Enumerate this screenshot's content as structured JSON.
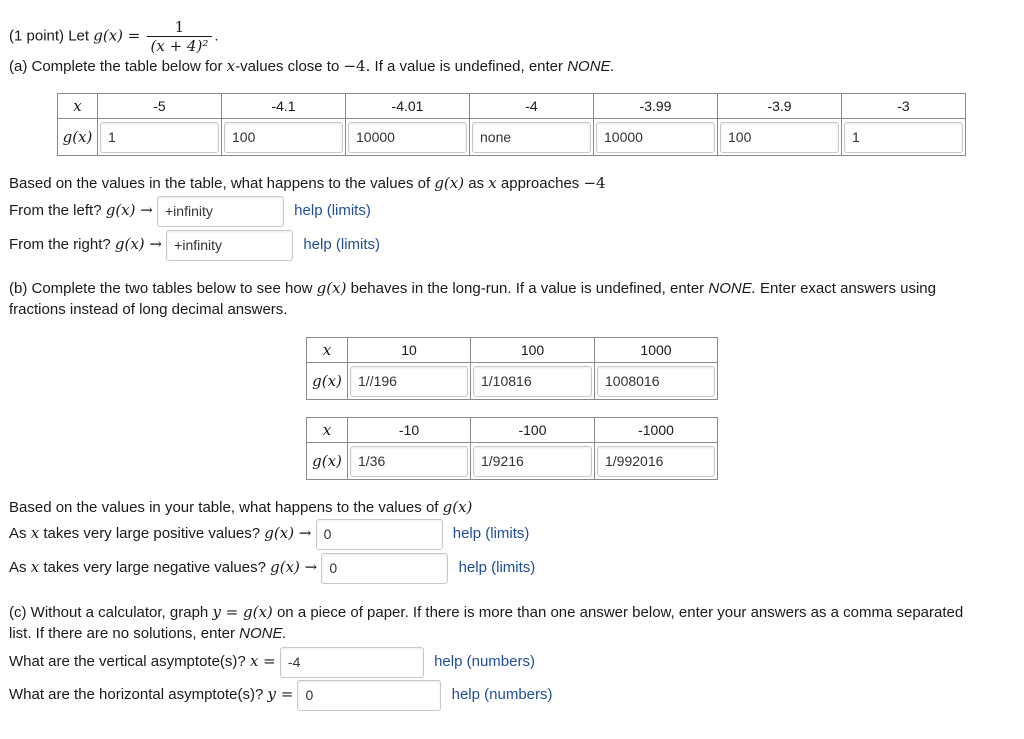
{
  "problem": {
    "points": "(1 point)",
    "let": "Let",
    "func": "g(x) =",
    "frac_num": "1",
    "frac_den": "(x + 4)²"
  },
  "part_a": {
    "intro_a": "(a) Complete the table below for",
    "intro_x": "x",
    "intro_b": "-values close to",
    "intro_val": "−4.",
    "intro_c": "If a value is undefined, enter",
    "none_word": "NONE.",
    "x_label": "x",
    "g_label": "g(x)",
    "x_values": [
      "-5",
      "-4.1",
      "-4.01",
      "-4",
      "-3.99",
      "-3.9",
      "-3"
    ],
    "g_values": [
      "1",
      "100",
      "10000",
      "none",
      "10000",
      "100",
      "1"
    ],
    "question_a": "Based on the values in the table, what happens to the values of",
    "question_g": "g(x)",
    "question_b": "as",
    "question_x": "x",
    "question_c": "approaches",
    "question_val": "−4",
    "left_prompt": "From the left?",
    "left_g": "g(x) →",
    "left_answer": "+infinity",
    "right_prompt": "From the right?",
    "right_g": "g(x) →",
    "right_answer": "+infinity",
    "help_limits": "help (limits)"
  },
  "part_b": {
    "intro_a": "(b) Complete the two tables below to see how",
    "intro_g": "g(x)",
    "intro_b": "behaves in the long-run. If a value is undefined, enter",
    "none_word": "NONE.",
    "intro_c": "Enter exact answers using",
    "intro_d": "fractions instead of long decimal answers.",
    "x_label": "x",
    "g_label": "g(x)",
    "table1_x": [
      "10",
      "100",
      "1000"
    ],
    "table1_g": [
      "1//196",
      "1/10816",
      "1008016"
    ],
    "table2_x": [
      "-10",
      "-100",
      "-1000"
    ],
    "table2_g": [
      "1/36",
      "1/9216",
      "1/992016"
    ],
    "question_a": "Based on the values in your table, what happens to the values of",
    "question_g": "g(x)",
    "pos_a": "As",
    "pos_x": "x",
    "pos_b": "takes very large positive values?",
    "pos_g": "g(x) →",
    "pos_answer": "0",
    "neg_a": "As",
    "neg_x": "x",
    "neg_b": "takes very large negative values?",
    "neg_g": "g(x) →",
    "neg_answer": "0",
    "help_limits": "help (limits)"
  },
  "part_c": {
    "intro_a": "(c) Without a calculator, graph",
    "intro_eq": "y = g(x)",
    "intro_b": "on a piece of paper. If there is more than one answer below, enter your answers as a comma separated",
    "intro_c": "list. If there are no solutions, enter",
    "none_word": "NONE.",
    "vert_prompt": "What are the vertical asymptote(s)?",
    "vert_eq": "x =",
    "vert_answer": "-4",
    "horiz_prompt": "What are the horizontal asymptote(s)?",
    "horiz_eq": "y =",
    "horiz_answer": "0",
    "help_numbers": "help (numbers)"
  }
}
